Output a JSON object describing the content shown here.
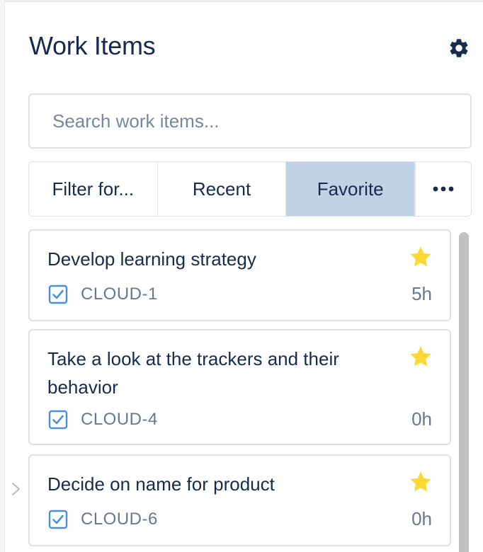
{
  "header": {
    "title": "Work Items"
  },
  "search": {
    "placeholder": "Search work items...",
    "value": ""
  },
  "tabs": [
    {
      "label": "Filter for...",
      "active": false
    },
    {
      "label": "Recent",
      "active": false
    },
    {
      "label": "Favorite",
      "active": true
    }
  ],
  "items": [
    {
      "title": "Develop learning strategy",
      "key": "CLOUD-1",
      "estimate": "5h",
      "favorite": true
    },
    {
      "title": "Take a look at the trackers and their behavior",
      "key": "CLOUD-4",
      "estimate": "0h",
      "favorite": true
    },
    {
      "title": "Decide on name for product",
      "key": "CLOUD-6",
      "estimate": "0h",
      "favorite": true
    }
  ],
  "icons": {
    "settings": "gear-icon",
    "more": "more-horizontal-icon",
    "favorite": "star-icon",
    "task": "checkbox-icon",
    "collapse": "chevron-right-icon"
  },
  "colors": {
    "active_tab": "#c1d1e6",
    "star": "#fdd835",
    "task_icon": "#4a90e2",
    "text_primary": "#172b4d",
    "text_secondary": "#6b778c"
  }
}
